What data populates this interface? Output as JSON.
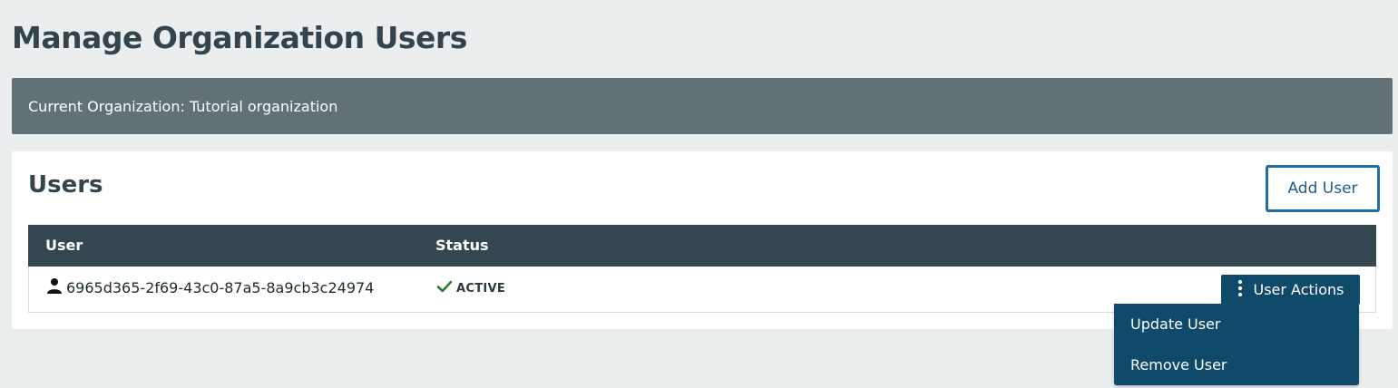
{
  "page": {
    "title": "Manage Organization Users"
  },
  "organization_banner": {
    "text": "Current Organization: Tutorial organization"
  },
  "users_section": {
    "heading": "Users",
    "add_user_label": "Add User",
    "table": {
      "columns": [
        "User",
        "Status"
      ],
      "rows": [
        {
          "user_id": "6965d365-2f69-43c0-87a5-8a9cb3c24974",
          "status": "ACTIVE",
          "actions_label": "User Actions"
        }
      ]
    }
  },
  "actions_menu": {
    "items": [
      {
        "label": "Update User"
      },
      {
        "label": "Remove User"
      }
    ]
  },
  "icons": {
    "user": "person-icon",
    "status": "checkmark-icon",
    "actions": "vertical-ellipsis-icon"
  },
  "colors": {
    "background": "#eaeeef",
    "banner": "#627176",
    "table_header": "#344650",
    "primary": "#0f4a6a",
    "accent_border": "#1f6fa6",
    "success": "#2e7d32"
  }
}
